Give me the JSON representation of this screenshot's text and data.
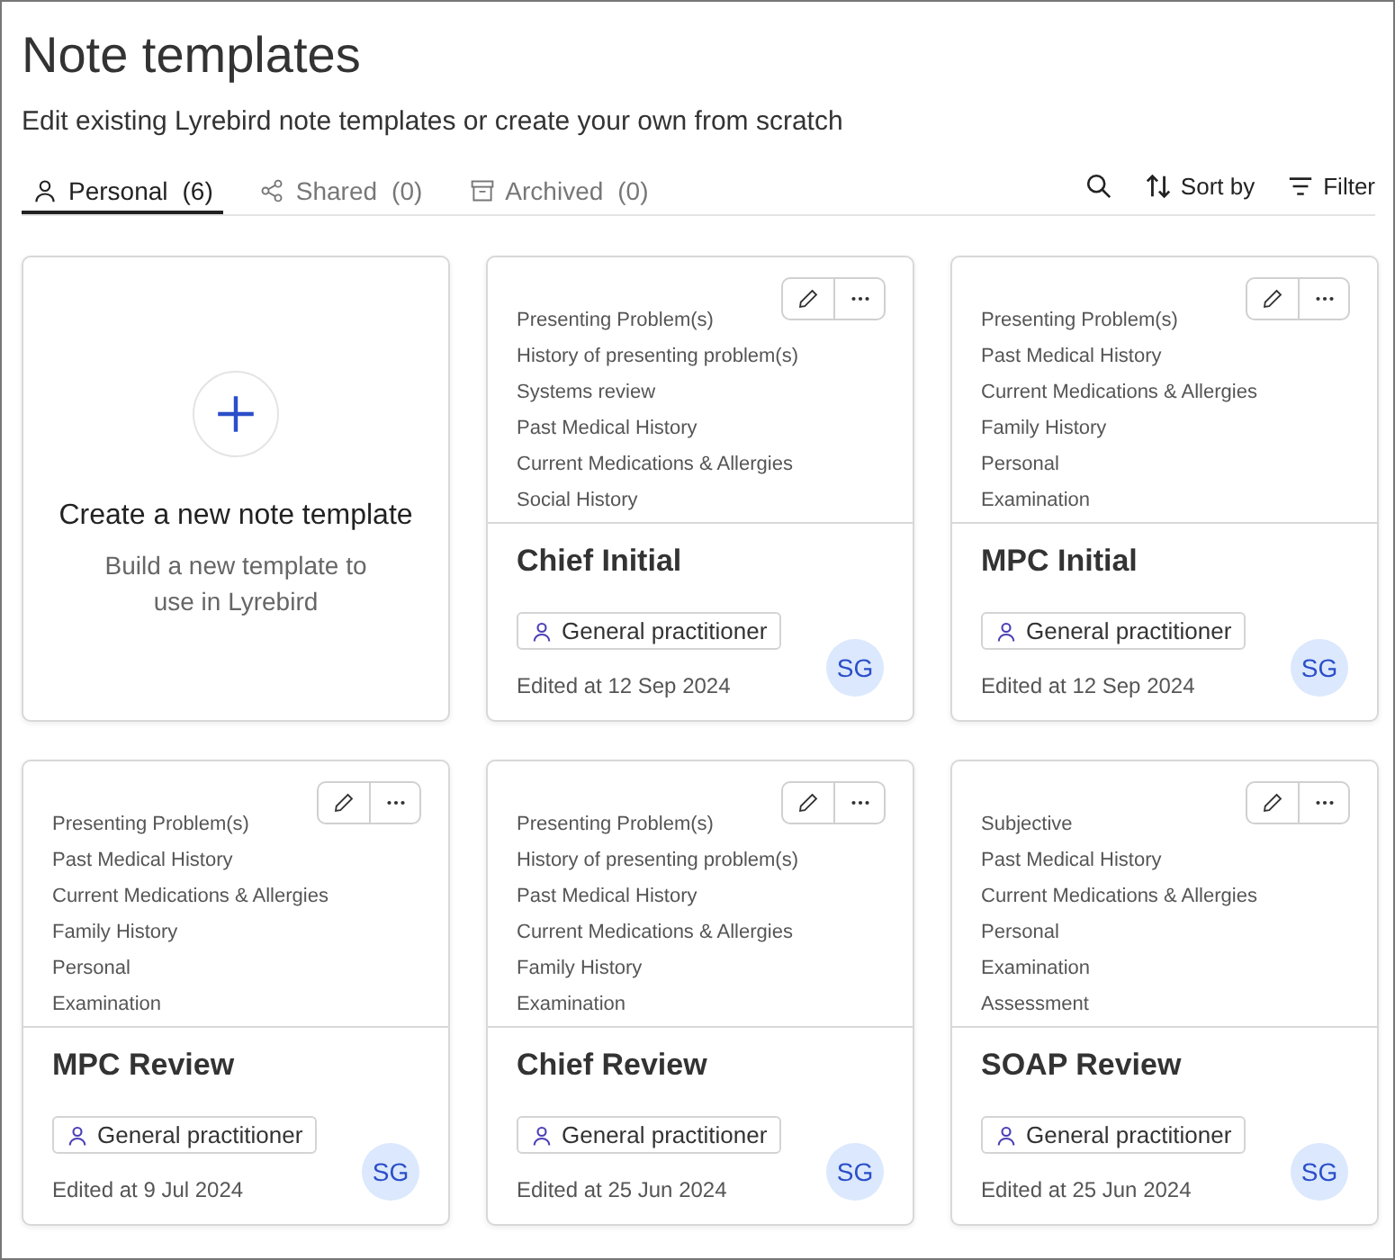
{
  "header": {
    "title": "Note templates",
    "subtitle": "Edit existing Lyrebird note templates or create your own from scratch"
  },
  "tabs": [
    {
      "label": "Personal",
      "count": "(6)",
      "selected": true
    },
    {
      "label": "Shared",
      "count": "(0)",
      "selected": false
    },
    {
      "label": "Archived",
      "count": "(0)",
      "selected": false
    }
  ],
  "toolbar": {
    "sort": "Sort by",
    "filter": "Filter"
  },
  "create_card": {
    "title": "Create a new note template",
    "description": "Build a new template to use in Lyrebird"
  },
  "templates": [
    {
      "name": "Chief Initial",
      "sections": [
        "Presenting Problem(s)",
        "History of presenting problem(s)",
        "Systems review",
        "Past Medical History",
        "Current Medications & Allergies",
        "Social History"
      ],
      "tag": "General practitioner",
      "edited": "Edited at 12 Sep 2024",
      "avatar": "SG"
    },
    {
      "name": "MPC Initial",
      "sections": [
        "Presenting Problem(s)",
        "Past Medical History",
        "Current Medications & Allergies",
        "Family History",
        "Personal",
        "Examination"
      ],
      "tag": "General practitioner",
      "edited": "Edited at 12 Sep 2024",
      "avatar": "SG"
    },
    {
      "name": "MPC Review",
      "sections": [
        "Presenting Problem(s)",
        "Past Medical History",
        "Current Medications & Allergies",
        "Family History",
        "Personal",
        "Examination"
      ],
      "tag": "General practitioner",
      "edited": "Edited at 9 Jul 2024",
      "avatar": "SG"
    },
    {
      "name": "Chief Review",
      "sections": [
        "Presenting Problem(s)",
        "History of presenting problem(s)",
        "Past Medical History",
        "Current Medications & Allergies",
        "Family History",
        "Examination"
      ],
      "tag": "General practitioner",
      "edited": "Edited at 25 Jun 2024",
      "avatar": "SG"
    },
    {
      "name": "SOAP Review",
      "sections": [
        "Subjective",
        "Past Medical History",
        "Current Medications & Allergies",
        "Personal",
        "Examination",
        "Assessment"
      ],
      "tag": "General practitioner",
      "edited": "Edited at 25 Jun 2024",
      "avatar": "SG"
    }
  ]
}
